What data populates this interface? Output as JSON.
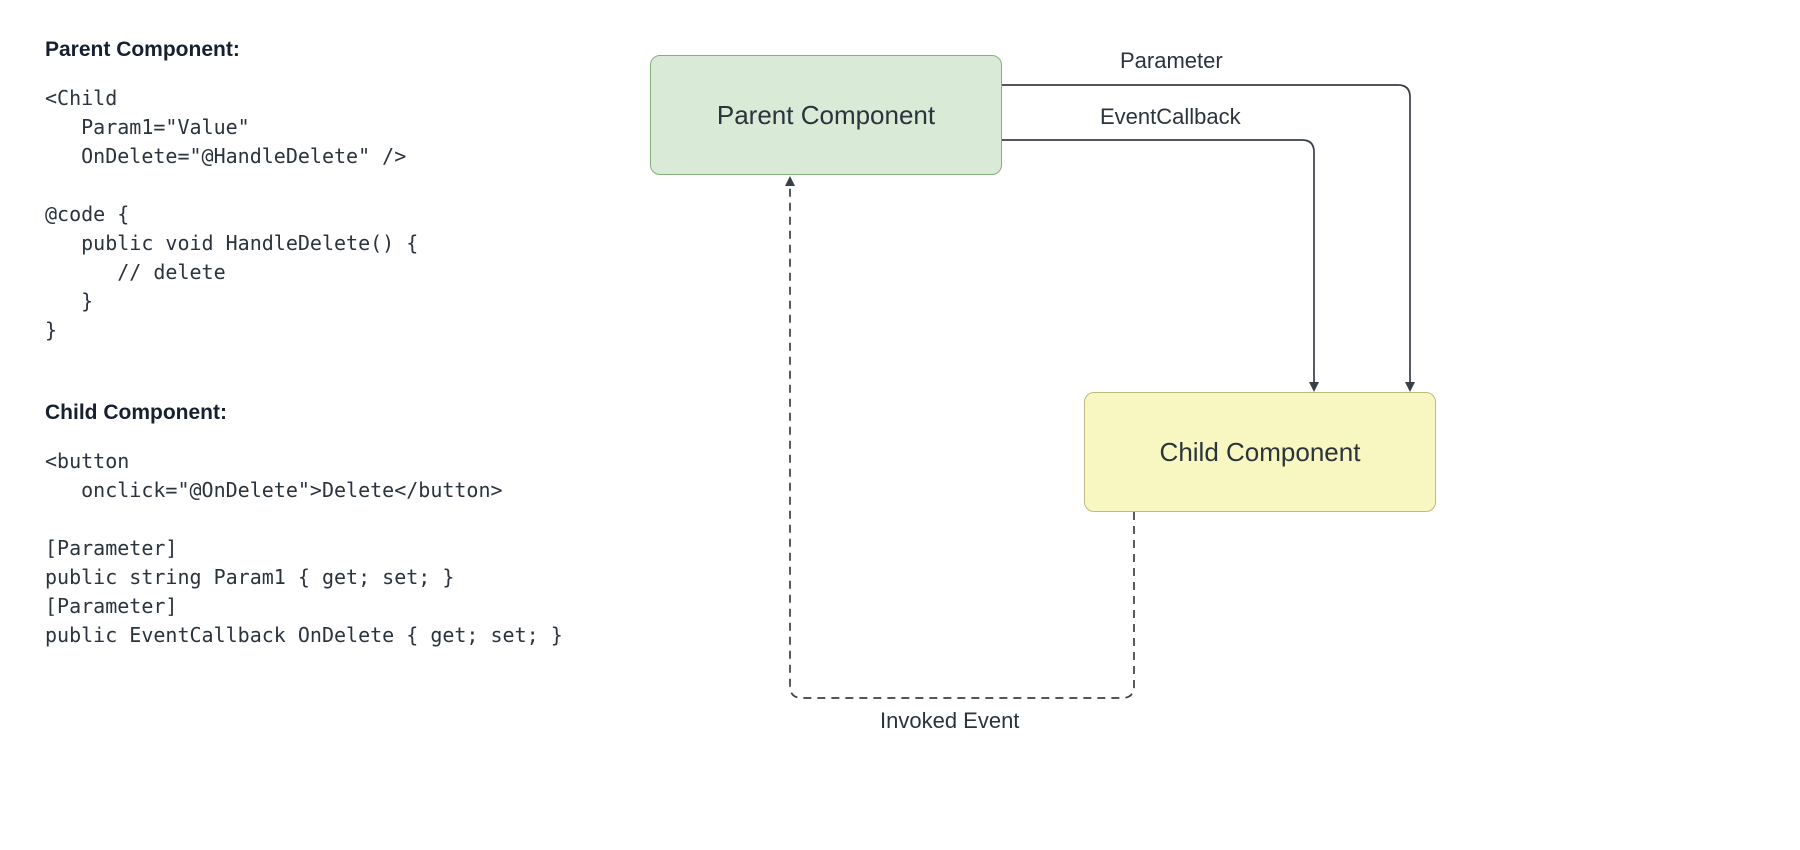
{
  "left": {
    "parent_heading": "Parent Component:",
    "parent_code": "<Child\n   Param1=\"Value\"\n   OnDelete=\"@HandleDelete\" />\n\n@code {\n   public void HandleDelete() {\n      // delete\n   }\n}",
    "child_heading": "Child Component:",
    "child_code": "<button\n   onclick=\"@OnDelete\">Delete</button>\n\n[Parameter]\npublic string Param1 { get; set; }\n[Parameter]\npublic EventCallback OnDelete { get; set; }"
  },
  "diagram": {
    "parent_label": "Parent Component",
    "child_label": "Child Component",
    "arrow_parameter": "Parameter",
    "arrow_eventcallback": "EventCallback",
    "arrow_invoked": "Invoked Event"
  },
  "colors": {
    "parent_bg": "#d9ead6",
    "parent_border": "#85b07e",
    "child_bg": "#f9f7c1",
    "child_border": "#bdbb80",
    "text": "#2b333d",
    "line": "#393f47"
  }
}
